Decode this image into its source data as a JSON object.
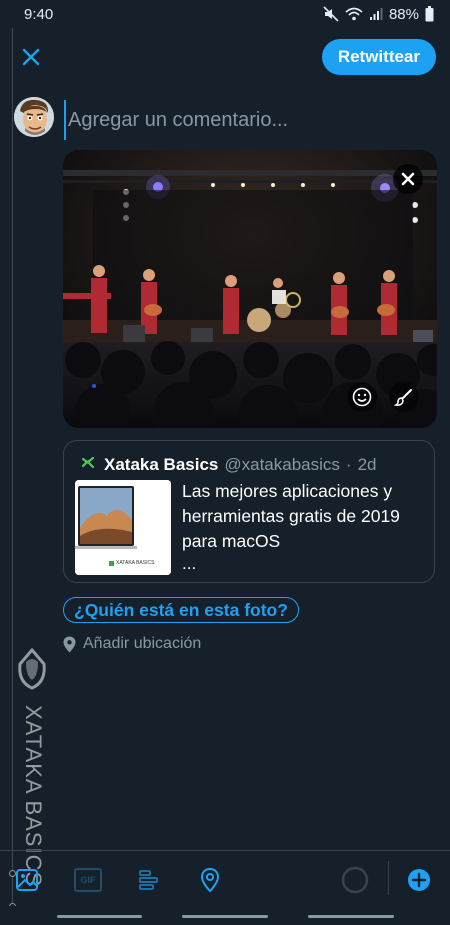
{
  "status_bar": {
    "time": "9:40",
    "battery": "88%"
  },
  "header": {
    "retweet_label": "Retwittear"
  },
  "compose": {
    "placeholder": "Agregar un comentario..."
  },
  "quoted_tweet": {
    "name": "Xataka Basics",
    "handle": "@xatakabasics",
    "separator": "·",
    "time": "2d",
    "text": "Las mejores aplicaciones y herramientas gratis de 2019 para macOS",
    "ellipsis": "...",
    "thumb_caption": "XATAKA BASICS"
  },
  "tag_people": {
    "label": "¿Quién está en esta foto?"
  },
  "location": {
    "label": "Añadir ubicación"
  },
  "watermark": {
    "text": "XATAKA BASICS"
  },
  "toolbar": {
    "gif_label": "GIF"
  },
  "colors": {
    "accent": "#1da1f2",
    "background": "#15202b",
    "secondary_text": "#8899a6",
    "border": "#38444d"
  }
}
